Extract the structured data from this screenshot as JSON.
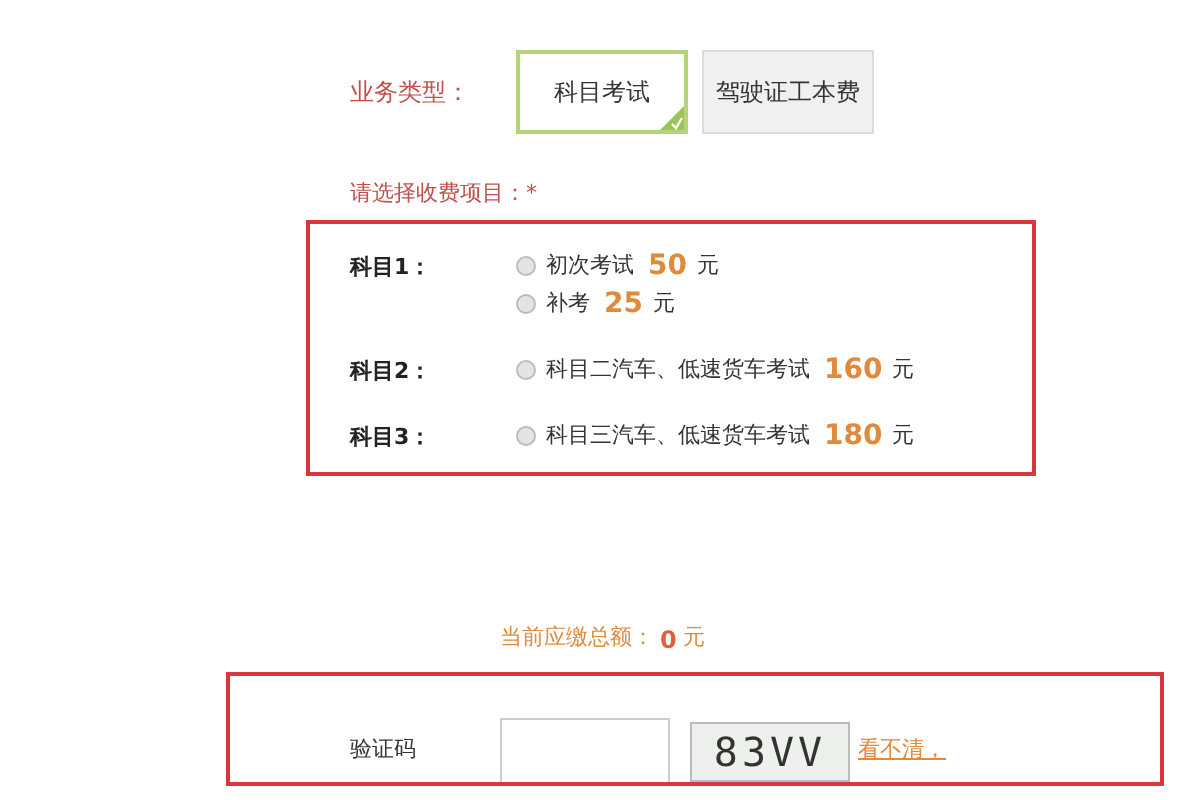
{
  "business_type": {
    "label": "业务类型：",
    "options": [
      {
        "label": "科目考试",
        "selected": true
      },
      {
        "label": "驾驶证工本费",
        "selected": false
      }
    ]
  },
  "fee_prompt": "请选择收费项目：*",
  "subjects": [
    {
      "label": "科目1：",
      "items": [
        {
          "text": "初次考试",
          "price": "50",
          "unit": "元",
          "checked": false
        },
        {
          "text": "补考",
          "price": "25",
          "unit": "元",
          "checked": false
        }
      ]
    },
    {
      "label": "科目2：",
      "items": [
        {
          "text": "科目二汽车、低速货车考试",
          "price": "160",
          "unit": "元",
          "checked": false
        }
      ]
    },
    {
      "label": "科目3：",
      "items": [
        {
          "text": "科目三汽车、低速货车考试",
          "price": "180",
          "unit": "元",
          "checked": false
        }
      ]
    }
  ],
  "total": {
    "label": "当前应缴总额：",
    "amount": "0",
    "unit": "元"
  },
  "captcha": {
    "label": "验证码",
    "code": "83VV",
    "refresh_link": "看不清，"
  }
}
